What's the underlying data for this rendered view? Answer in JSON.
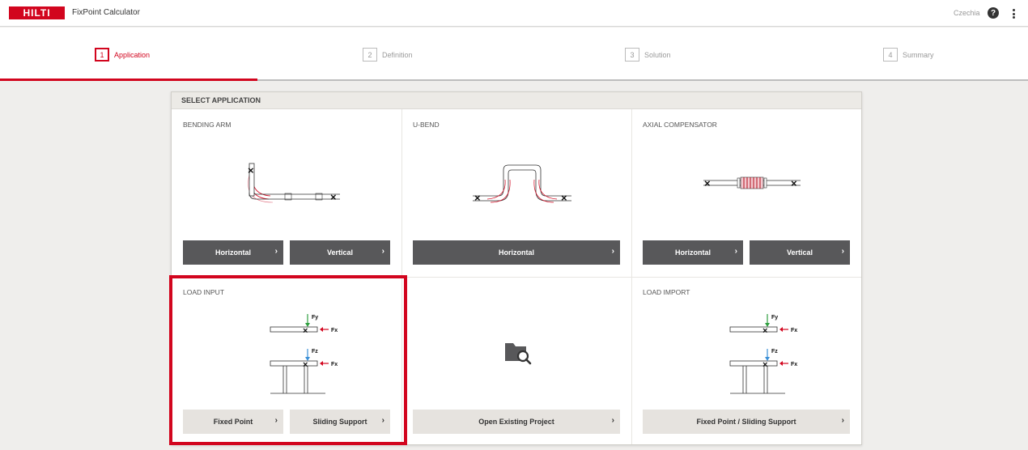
{
  "header": {
    "logo_text": "HILTI",
    "app_title": "FixPoint Calculator",
    "country": "Czechia",
    "help_icon": "question-circle-icon",
    "menu_icon": "kebab-menu-icon"
  },
  "stepper": {
    "steps": [
      {
        "number": "1",
        "label": "Application",
        "active": true
      },
      {
        "number": "2",
        "label": "Definition",
        "active": false
      },
      {
        "number": "3",
        "label": "Solution",
        "active": false
      },
      {
        "number": "4",
        "label": "Summary",
        "active": false
      }
    ]
  },
  "panel": {
    "title": "SELECT APPLICATION",
    "cells": {
      "bending_arm": {
        "title": "BENDING ARM",
        "buttons": [
          "Horizontal",
          "Vertical"
        ]
      },
      "u_bend": {
        "title": "U-BEND",
        "buttons": [
          "Horizontal"
        ]
      },
      "axial_compensator": {
        "title": "AXIAL COMPENSATOR",
        "buttons": [
          "Horizontal",
          "Vertical"
        ]
      },
      "load_input": {
        "title": "LOAD INPUT",
        "buttons": [
          "Fixed Point",
          "Sliding Support"
        ],
        "labels": {
          "fy": "Fy",
          "fx": "Fx",
          "fz": "Fz"
        }
      },
      "open_project": {
        "title": "",
        "icon": "folder-search-icon",
        "buttons": [
          "Open Existing Project"
        ]
      },
      "load_import": {
        "title": "LOAD IMPORT",
        "buttons": [
          "Fixed Point / Sliding Support"
        ],
        "labels": {
          "fy": "Fy",
          "fx": "Fx",
          "fz": "Fz"
        }
      }
    }
  },
  "colors": {
    "brand_red": "#d2051e",
    "dark_button": "#58585a",
    "light_button": "#e6e3df",
    "force_green": "#2e9e3e",
    "force_blue": "#3a8fd6"
  },
  "chevron": "›"
}
